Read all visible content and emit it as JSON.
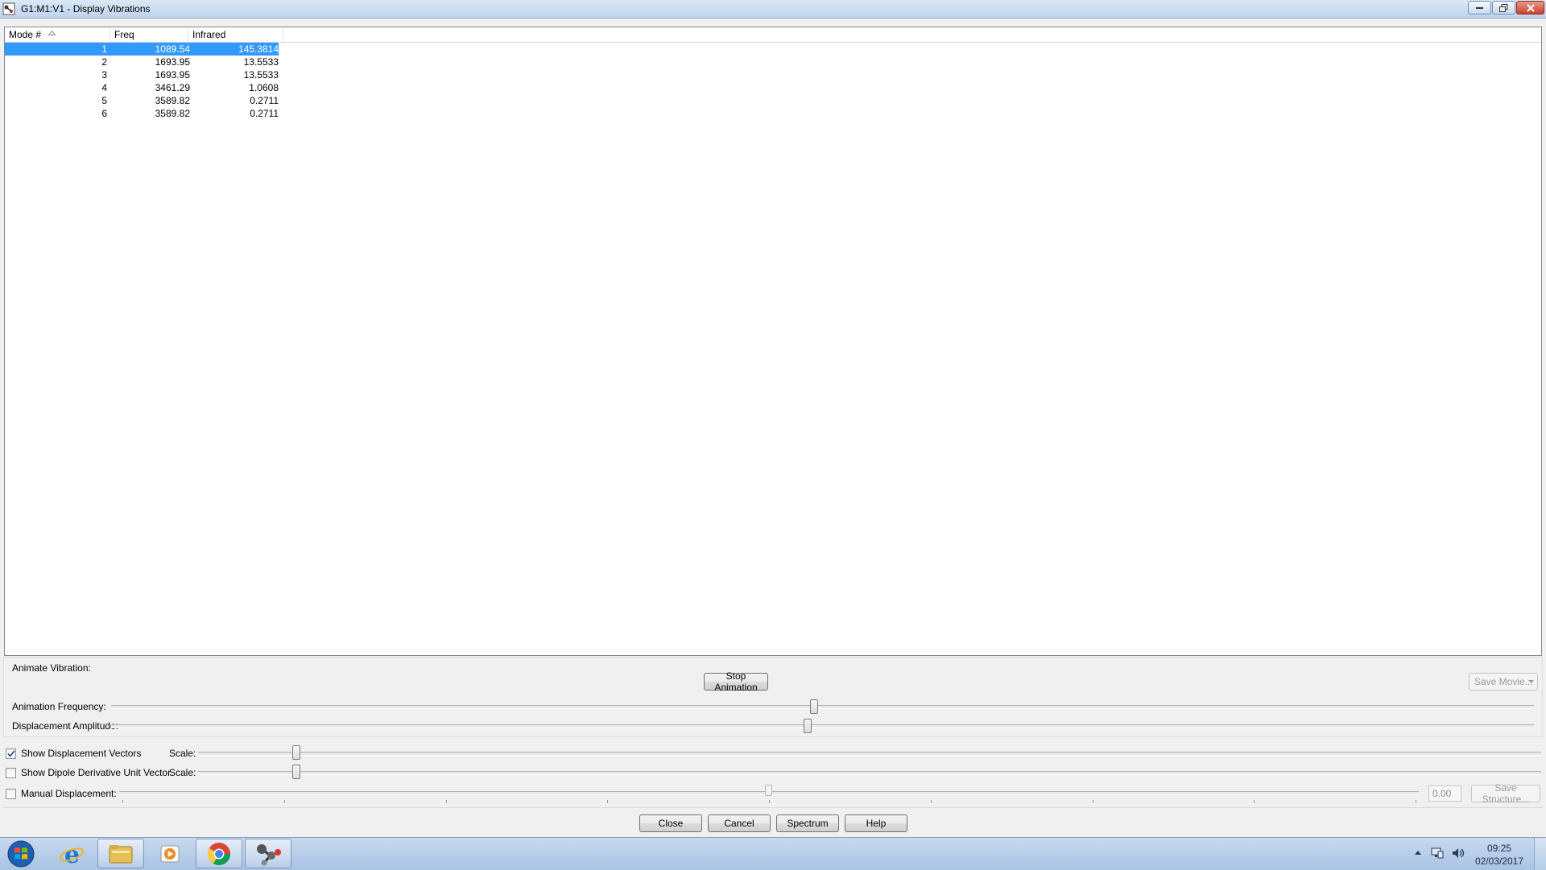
{
  "window": {
    "title": "G1:M1:V1 - Display Vibrations"
  },
  "table": {
    "columns": [
      "Mode #",
      "Freq",
      "Infrared"
    ],
    "rows": [
      {
        "mode": "1",
        "freq": "1089.54",
        "infrared": "145.3814",
        "selected": true
      },
      {
        "mode": "2",
        "freq": "1693.95",
        "infrared": "13.5533"
      },
      {
        "mode": "3",
        "freq": "1693.95",
        "infrared": "13.5533"
      },
      {
        "mode": "4",
        "freq": "3461.29",
        "infrared": "1.0608"
      },
      {
        "mode": "5",
        "freq": "3589.82",
        "infrared": "0.2711"
      },
      {
        "mode": "6",
        "freq": "3589.82",
        "infrared": "0.2711"
      }
    ]
  },
  "animate": {
    "label": "Animate Vibration:",
    "stop_button": "Stop Animation",
    "save_movie": "Save Movie...",
    "frequency_label": "Animation Frequency:",
    "amplitude_label": "Displacement Amplitude:",
    "frequency_value_fraction": 0.49,
    "amplitude_value_fraction": 0.49
  },
  "vectors": {
    "show_displacement_label": "Show Displacement Vectors",
    "show_displacement_checked": true,
    "show_dipole_label": "Show Dipole Derivative Unit Vector",
    "show_dipole_checked": false,
    "scale_label": "Scale:",
    "displacement_scale_fraction": 0.07,
    "dipole_scale_fraction": 0.07
  },
  "manual": {
    "label": "Manual Displacement:",
    "checked": false,
    "value": "0.00",
    "save_structure": "Save Structure...",
    "value_fraction": 0.5
  },
  "dialog_buttons": {
    "close": "Close",
    "cancel": "Cancel",
    "spectrum": "Spectrum",
    "help": "Help"
  },
  "taskbar": {
    "time": "09:25",
    "date": "02/03/2017",
    "apps": [
      "start-orb",
      "internet-explorer",
      "file-explorer",
      "media-player",
      "chrome",
      "gaussview"
    ]
  }
}
